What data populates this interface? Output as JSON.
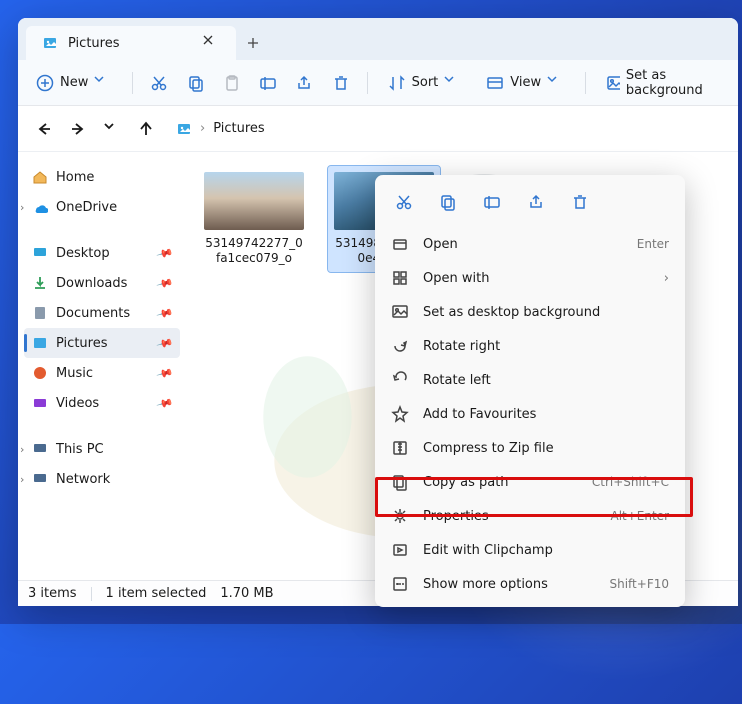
{
  "tab": {
    "title": "Pictures"
  },
  "toolbar": {
    "new": "New",
    "sort": "Sort",
    "view": "View",
    "setbg": "Set as background"
  },
  "breadcrumb": {
    "current": "Pictures"
  },
  "sidebar": {
    "home": "Home",
    "onedrive": "OneDrive",
    "desktop": "Desktop",
    "downloads": "Downloads",
    "documents": "Documents",
    "pictures": "Pictures",
    "music": "Music",
    "videos": "Videos",
    "thispc": "This PC",
    "network": "Network"
  },
  "files": {
    "f1": "53149742277_0fa1cec079_o",
    "f2": "53149855290_40e47e09"
  },
  "status": {
    "count": "3 items",
    "selected": "1 item selected",
    "size": "1.70 MB"
  },
  "ctx": {
    "open": "Open",
    "open_s": "Enter",
    "openwith": "Open with",
    "setbg": "Set as desktop background",
    "rotr": "Rotate right",
    "rotl": "Rotate left",
    "fav": "Add to Favourites",
    "zip": "Compress to Zip file",
    "copypath": "Copy as path",
    "copypath_s": "Ctrl+Shift+C",
    "props": "Properties",
    "props_s": "Alt+Enter",
    "clip": "Edit with Clipchamp",
    "more": "Show more options",
    "more_s": "Shift+F10"
  }
}
